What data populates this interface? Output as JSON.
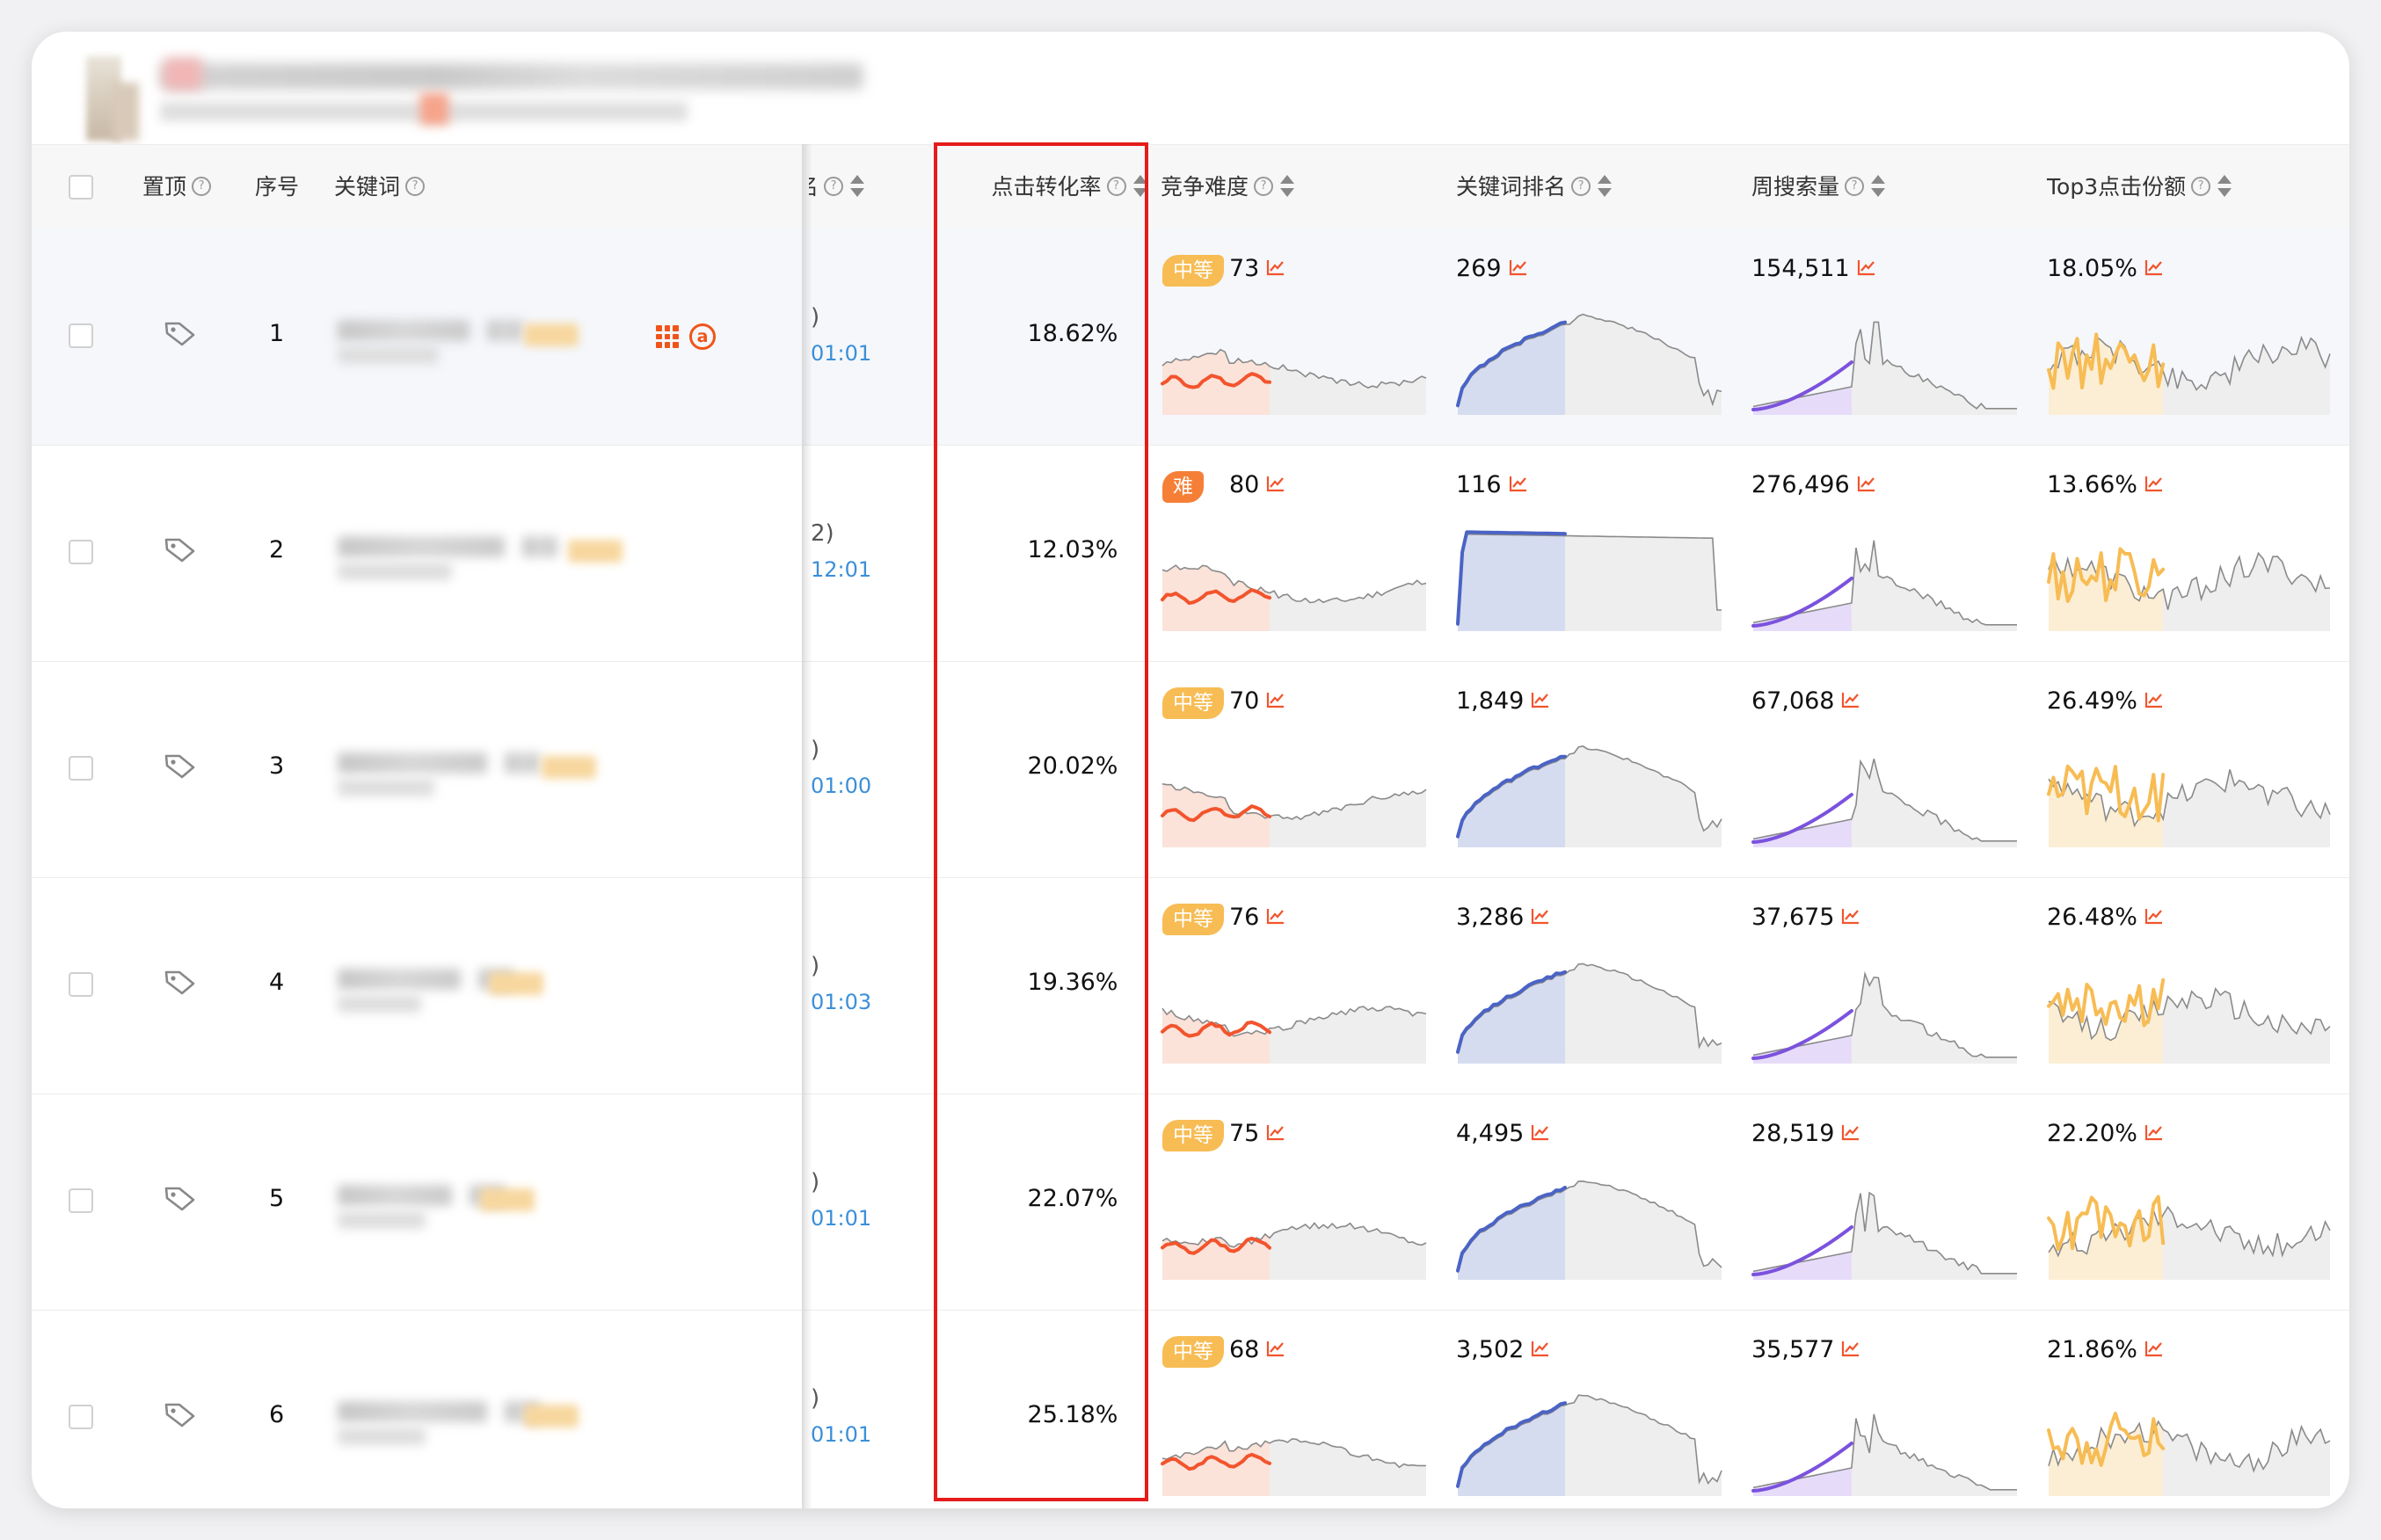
{
  "header": {
    "checkbox_all": "",
    "col_pin": "置顶",
    "col_index": "序号",
    "col_keyword": "关键词",
    "col_partial": "名",
    "col_conversion": "点击转化率",
    "col_difficulty": "竞争难度",
    "col_rank": "关键词排名",
    "col_search": "周搜索量",
    "col_top3": "Top3点击份额"
  },
  "colors": {
    "difficulty_line": "#f2542d",
    "rank_line": "#4a63c5",
    "search_line": "#7b52dd",
    "top3_line": "#f7bc54",
    "gray_line": "#8a8a8a",
    "highlight_box": "#e61b1b",
    "badge_mid": "#f7bc54",
    "badge_hard": "#f57f37",
    "time_link": "#3b8fd8"
  },
  "rows": [
    {
      "index": "1",
      "partial_top": ")",
      "partial_time": "01:01",
      "conversion": "18.62%",
      "difficulty_label": "中等",
      "difficulty_level": "mid",
      "difficulty": "73",
      "rank": "269",
      "search": "154,511",
      "top3": "18.05%"
    },
    {
      "index": "2",
      "partial_top": "2)",
      "partial_time": "12:01",
      "conversion": "12.03%",
      "difficulty_label": "难",
      "difficulty_level": "hard",
      "difficulty": "80",
      "rank": "116",
      "search": "276,496",
      "top3": "13.66%"
    },
    {
      "index": "3",
      "partial_top": ")",
      "partial_time": "01:00",
      "conversion": "20.02%",
      "difficulty_label": "中等",
      "difficulty_level": "mid",
      "difficulty": "70",
      "rank": "1,849",
      "search": "67,068",
      "top3": "26.49%"
    },
    {
      "index": "4",
      "partial_top": ")",
      "partial_time": "01:03",
      "conversion": "19.36%",
      "difficulty_label": "中等",
      "difficulty_level": "mid",
      "difficulty": "76",
      "rank": "3,286",
      "search": "37,675",
      "top3": "26.48%"
    },
    {
      "index": "5",
      "partial_top": ")",
      "partial_time": "01:01",
      "conversion": "22.07%",
      "difficulty_label": "中等",
      "difficulty_level": "mid",
      "difficulty": "75",
      "rank": "4,495",
      "search": "28,519",
      "top3": "22.20%"
    },
    {
      "index": "6",
      "partial_top": ")",
      "partial_time": "01:01",
      "conversion": "25.18%",
      "difficulty_label": "中等",
      "difficulty_level": "mid",
      "difficulty": "68",
      "rank": "3,502",
      "search": "35,577",
      "top3": "21.86%"
    }
  ],
  "icons": {
    "sort": "sort-icon",
    "help": "help-icon",
    "tag": "tag-icon",
    "trend": "trend-chart-icon",
    "grid": "grid-icon",
    "amazon": "amazon-icon"
  }
}
